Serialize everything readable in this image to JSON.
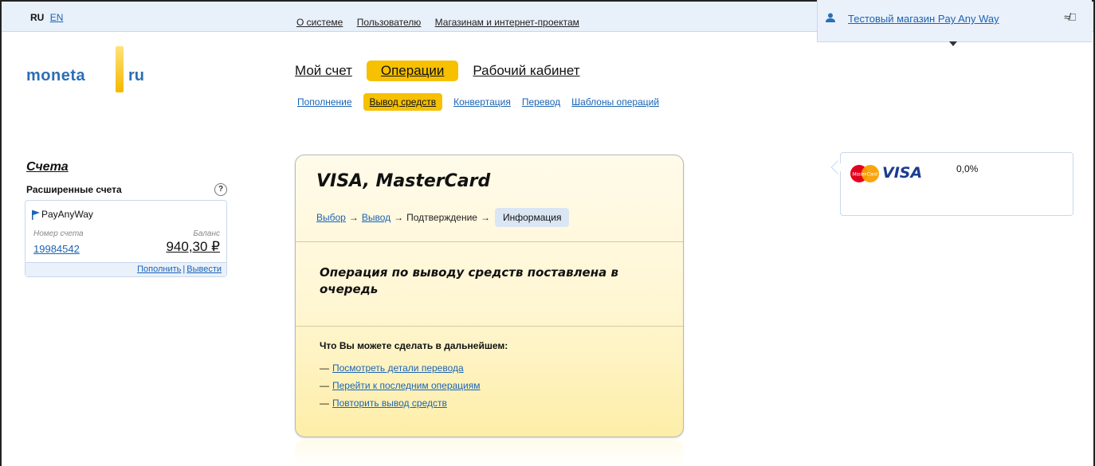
{
  "lang": {
    "ru": "RU",
    "en": "EN"
  },
  "topnav": {
    "about": "О системе",
    "user": "Пользователю",
    "shops": "Магазинам и интернет-проектам"
  },
  "user": {
    "name": "Тестовый магазин Pay Any Way",
    "exit_glyph": "≉⎕"
  },
  "logo": {
    "part1": "moneta",
    "part2": "ru"
  },
  "mainnav": {
    "account": "Мой счет",
    "operations": "Операции",
    "cabinet": "Рабочий кабинет"
  },
  "subnav": {
    "topup": "Пополнение",
    "withdraw": "Вывод средств",
    "convert": "Конвертация",
    "transfer": "Перевод",
    "templates": "Шаблоны операций"
  },
  "sidebar": {
    "title": "Счета",
    "subtitle": "Расширенные счета",
    "help": "?",
    "account": {
      "name": "PayAnyWay",
      "number_label": "Номер счета",
      "balance_label": "Баланс",
      "number": "19984542",
      "balance": "940,30 ₽",
      "topup": "Пополнить",
      "separator": "|",
      "withdraw": "Вывести"
    }
  },
  "card": {
    "title": "VISA, MasterCard",
    "steps": {
      "choice": "Выбор",
      "output": "Вывод",
      "confirm": "Подтверждение",
      "info": "Информация",
      "arrow": "→"
    },
    "message": "Операция по выводу средств поставлена в очередь",
    "next_title": "Что Вы можете сделать в дальнейшем:",
    "dash": "—",
    "next": [
      "Посмотреть детали перевода",
      "Перейти к последним операциям",
      "Повторить вывод средств"
    ]
  },
  "fee": {
    "visa": "VISA",
    "mc": "MasterCard",
    "value": "0,0%"
  },
  "colors": {
    "accent": "#f7c000",
    "link": "#1a64b4",
    "topbar": "#e8f0fa"
  }
}
